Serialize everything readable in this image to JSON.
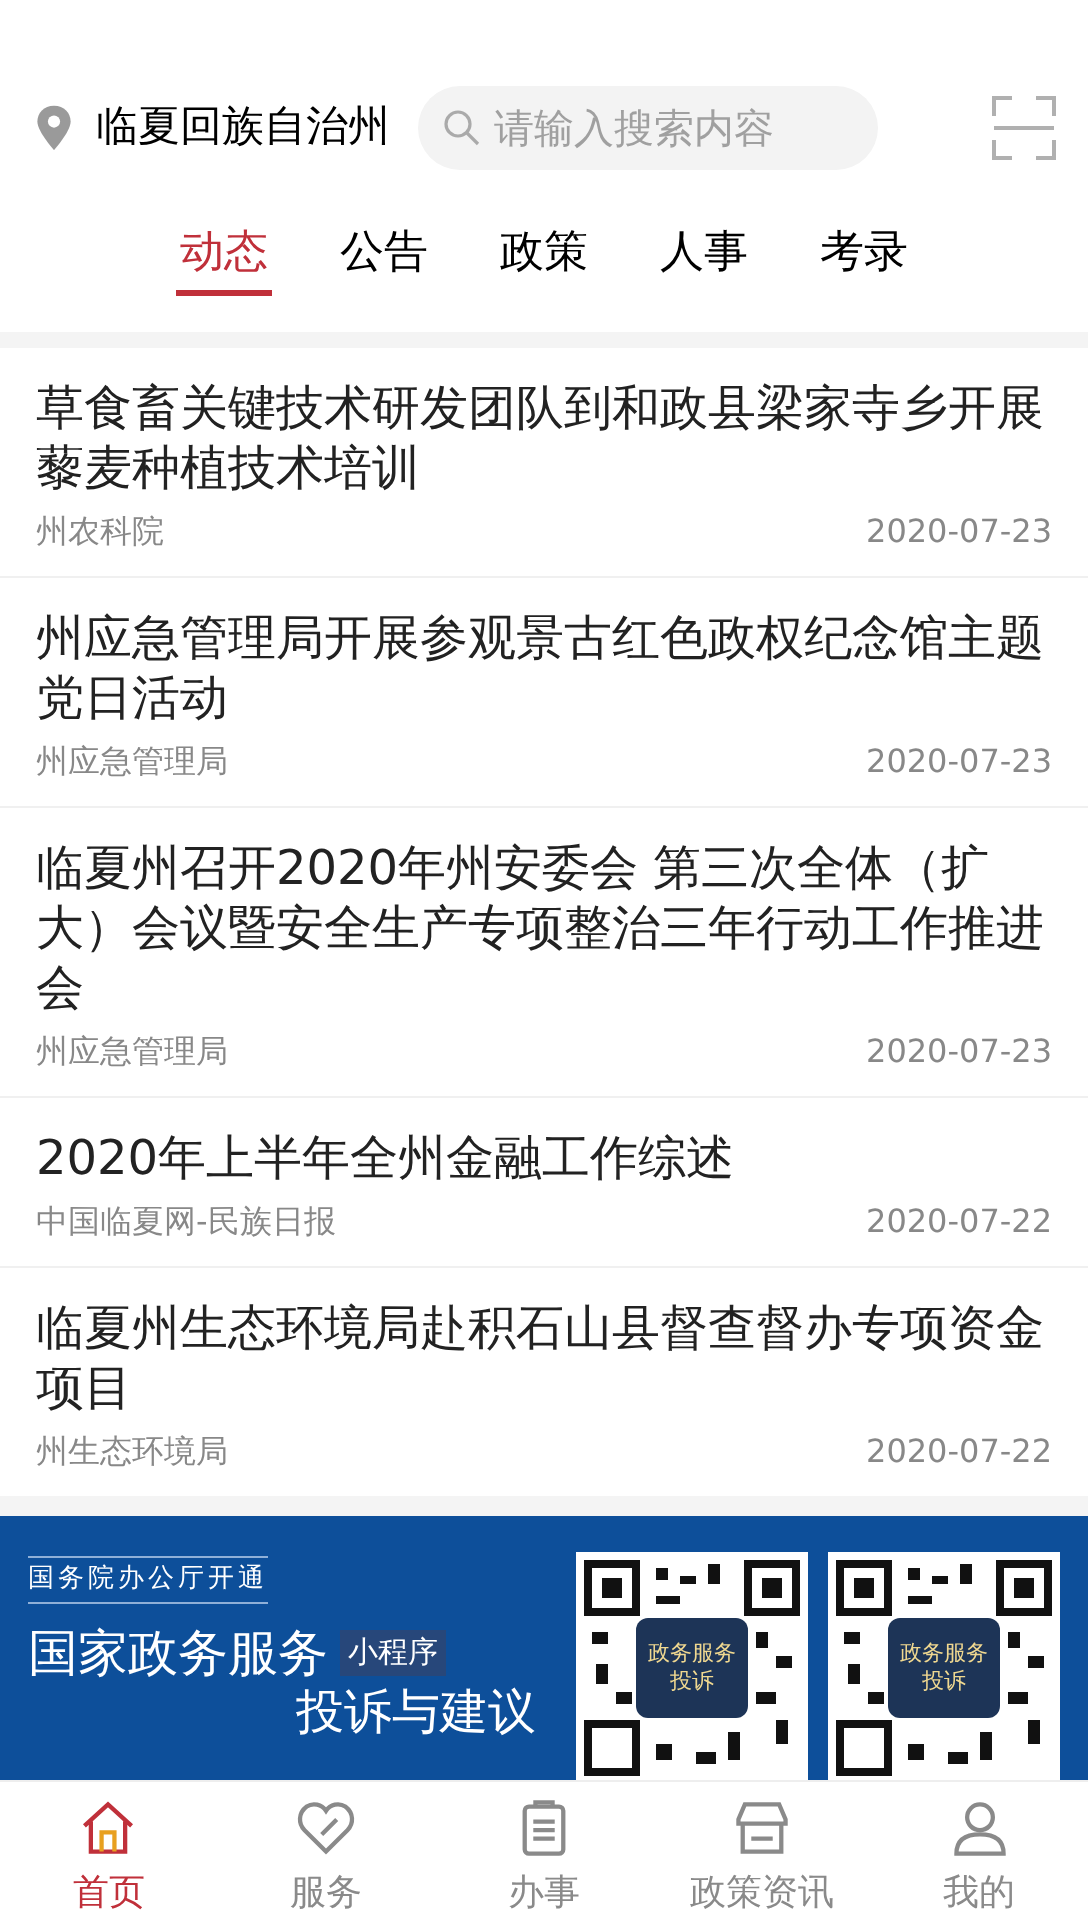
{
  "header": {
    "location": "临夏回族自治州",
    "search": {
      "placeholder": "请输入搜索内容"
    }
  },
  "tabs": [
    {
      "label": "动态",
      "selected": true
    },
    {
      "label": "公告",
      "selected": false
    },
    {
      "label": "政策",
      "selected": false
    },
    {
      "label": "人事",
      "selected": false
    },
    {
      "label": "考录",
      "selected": false
    }
  ],
  "news": [
    {
      "title": "草食畜关键技术研发团队到和政县梁家寺乡开展藜麦种植技术培训",
      "source": "州农科院",
      "date": "2020-07-23"
    },
    {
      "title": "州应急管理局开展参观景古红色政权纪念馆主题党日活动",
      "source": "州应急管理局",
      "date": "2020-07-23"
    },
    {
      "title": "临夏州召开2020年州安委会 第三次全体（扩大）会议暨安全生产专项整治三年行动工作推进会",
      "source": "州应急管理局",
      "date": "2020-07-23"
    },
    {
      "title": "2020年上半年全州金融工作综述",
      "source": "中国临夏网-民族日报",
      "date": "2020-07-22"
    },
    {
      "title": "临夏州生态环境局赴积石山县督查督办专项资金项目",
      "source": "州生态环境局",
      "date": "2020-07-22"
    }
  ],
  "banner": {
    "top_line": "国务院办公厅开通",
    "headline": "国家政务服务",
    "tag": "小程序",
    "subline": "投诉与建议",
    "qr_labels": [
      "政务服务投诉",
      "政务服务投诉"
    ]
  },
  "nav": [
    {
      "label": "首页",
      "selected": true,
      "kind": "home"
    },
    {
      "label": "服务",
      "selected": false,
      "kind": "service"
    },
    {
      "label": "办事",
      "selected": false,
      "kind": "tasks"
    },
    {
      "label": "政策资讯",
      "selected": false,
      "kind": "store"
    },
    {
      "label": "我的",
      "selected": false,
      "kind": "user"
    }
  ]
}
